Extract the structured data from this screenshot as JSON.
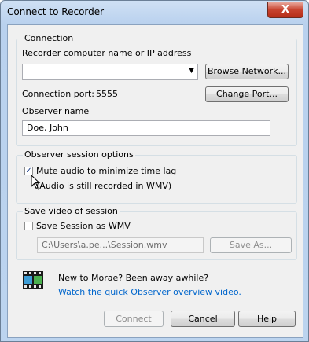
{
  "window": {
    "title": "Connect to Recorder",
    "close_symbol": "X"
  },
  "connection": {
    "legend": "Connection",
    "recorder_label": "Recorder computer name or IP address",
    "recorder_value": "",
    "browse_button": "Browse Network...",
    "port_label": "Connection port:",
    "port_value": "5555",
    "change_port_button": "Change Port...",
    "observer_label": "Observer name",
    "observer_value": "Doe, John"
  },
  "session_options": {
    "legend": "Observer session options",
    "mute_label": "Mute audio to minimize time lag",
    "mute_checked": true,
    "mute_note": "(Audio is still recorded in WMV)"
  },
  "save_video": {
    "legend": "Save video of session",
    "save_label": "Save Session as WMV",
    "save_checked": false,
    "path_value": "C:\\Users\\a.pe...\\Session.wmv",
    "save_as_button": "Save As..."
  },
  "promo": {
    "icon": "film-strip-icon",
    "line1": "New to Morae?  Been away awhile?",
    "link": "Watch the quick Observer overview video."
  },
  "footer": {
    "connect_button": "Connect",
    "cancel_button": "Cancel",
    "help_button": "Help"
  }
}
